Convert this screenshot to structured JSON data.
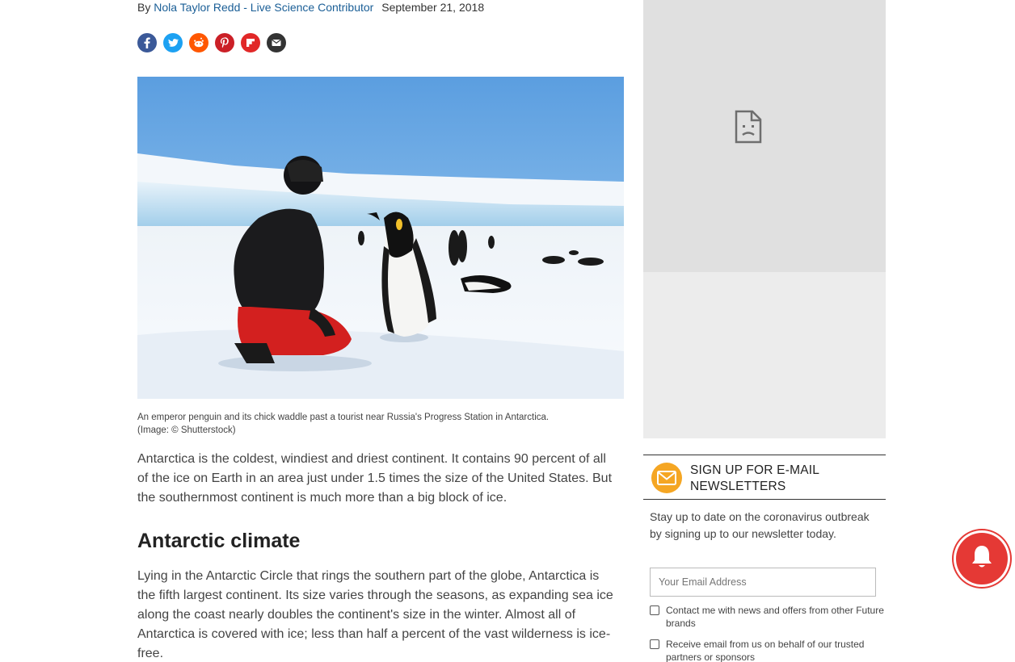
{
  "article": {
    "byline_prefix": "By",
    "author": "Nola Taylor Redd - Live Science Contributor",
    "date": "September 21, 2018",
    "share_icons": [
      "facebook-icon",
      "twitter-icon",
      "reddit-icon",
      "pinterest-icon",
      "flipboard-icon",
      "email-icon"
    ],
    "image_caption": "An emperor penguin and its chick waddle past a tourist near Russia's Progress Station in Antarctica.",
    "image_credit": "(Image: © Shutterstock)",
    "intro": "Antarctica is the coldest, windiest and driest continent. It contains 90 percent of all of the ice on Earth in an area just under 1.5 times the size of the United States. But the southernmost continent is much more than a big block of ice.",
    "section_heading": "Antarctic climate",
    "section_text": "Lying in the Antarctic Circle that rings the southern part of the globe, Antarctica is the fifth largest continent. Its size varies through the seasons, as expanding sea ice along the coast nearly doubles the continent's size in the winter. Almost all of Antarctica is covered with ice; less than half a percent of the vast wilderness is ice-free."
  },
  "sidebar": {
    "newsletter": {
      "title": "SIGN UP FOR E-MAIL NEWSLETTERS",
      "description": "Stay up to date on the coronavirus outbreak by signing up to our newsletter today.",
      "email_placeholder": "Your Email Address",
      "checkbox_1": "Contact me with news and offers from other Future brands",
      "checkbox_2": "Receive email from us on behalf of our trusted partners or sponsors"
    }
  },
  "colors": {
    "link": "#1a5e96",
    "newsletter_icon": "#f5a623",
    "notification_bell": "#e53935"
  }
}
